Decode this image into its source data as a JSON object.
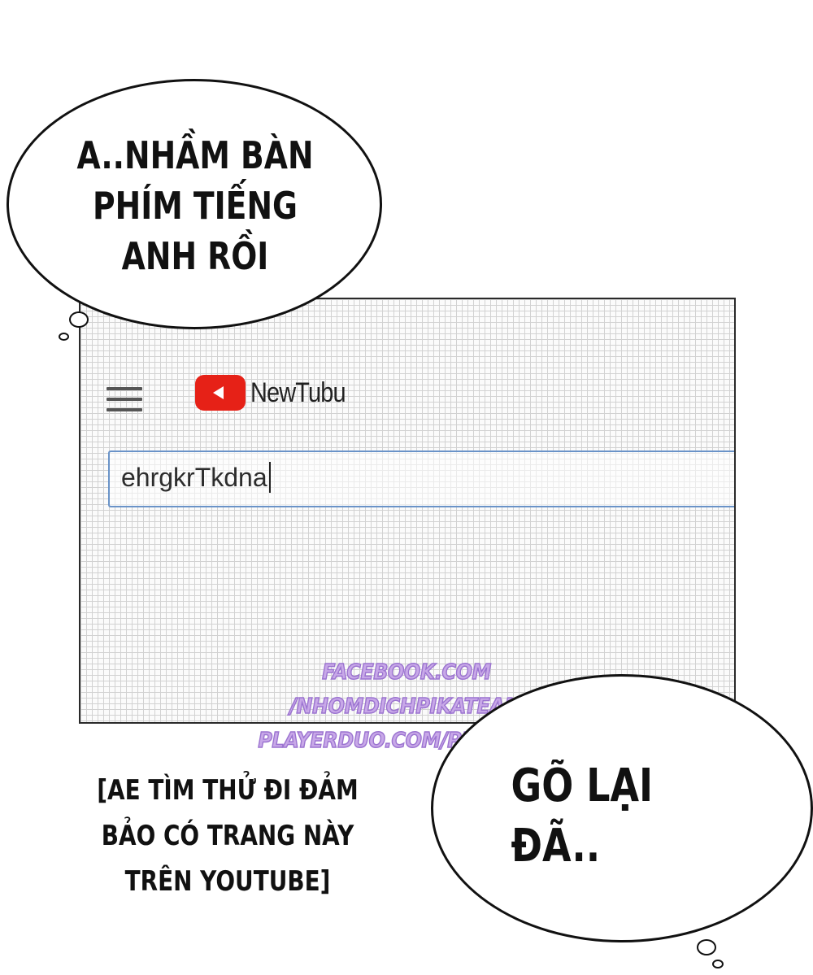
{
  "bubbles": {
    "top_left": {
      "line1": "A..NHẦM BÀN",
      "line2": "PHÍM TIẾNG",
      "line3": "ANH RỒI"
    },
    "bottom_right": {
      "line1": "GÕ LẠI",
      "line2": "ĐÃ.."
    }
  },
  "screenshot": {
    "menu_icon": "hamburger-menu-icon",
    "logo_icon": "play-logo-icon",
    "logo_text": "NewTubu",
    "search_value": "ehrgkrTkdna",
    "colors": {
      "logo_red": "#e62117",
      "search_border": "#6a93c8"
    }
  },
  "watermark": {
    "line1": "FACEBOOK.COM",
    "line2": "/NHOMDICHPIKATEAM",
    "line3": "PLAYERDUO.COM/PIKATEAM"
  },
  "note": {
    "line1": "[AE TÌM THỬ ĐI ĐẢM",
    "line2": "BẢO CÓ TRANG NÀY",
    "line3": "TRÊN YOUTUBE]"
  }
}
